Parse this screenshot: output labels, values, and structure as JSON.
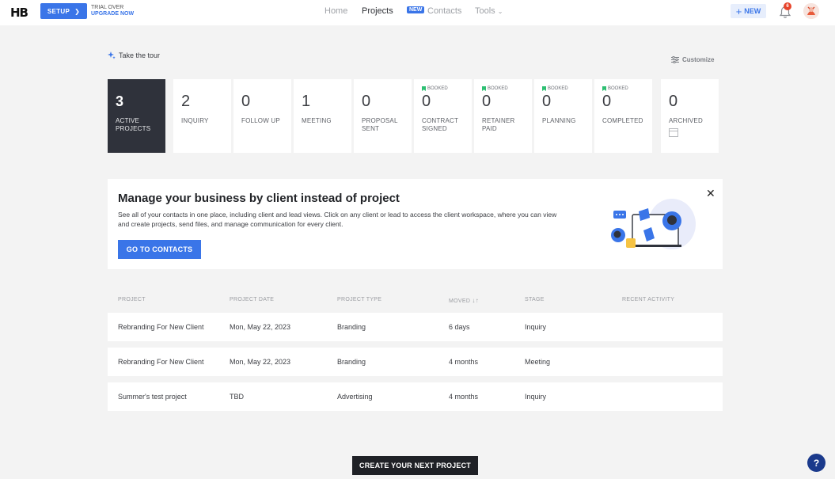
{
  "header": {
    "logo": "HB",
    "setup_label": "SETUP",
    "trial_status": "TRIAL OVER",
    "upgrade_label": "UPGRADE NOW",
    "nav": {
      "home": "Home",
      "projects": "Projects",
      "new_badge": "NEW",
      "contacts": "Contacts",
      "tools": "Tools"
    },
    "new_button": "NEW",
    "notification_count": "6"
  },
  "toolbar": {
    "tour": "Take the tour",
    "customize": "Customize"
  },
  "stages": [
    {
      "count": "3",
      "label": "ACTIVE PROJECTS",
      "booked": ""
    },
    {
      "count": "2",
      "label": "INQUIRY",
      "booked": ""
    },
    {
      "count": "0",
      "label": "FOLLOW UP",
      "booked": ""
    },
    {
      "count": "1",
      "label": "MEETING",
      "booked": ""
    },
    {
      "count": "0",
      "label": "PROPOSAL SENT",
      "booked": ""
    },
    {
      "count": "0",
      "label": "CONTRACT SIGNED",
      "booked": "BOOKED"
    },
    {
      "count": "0",
      "label": "RETAINER PAID",
      "booked": "BOOKED"
    },
    {
      "count": "0",
      "label": "PLANNING",
      "booked": "BOOKED"
    },
    {
      "count": "0",
      "label": "COMPLETED",
      "booked": "BOOKED"
    },
    {
      "count": "0",
      "label": "ARCHIVED",
      "booked": ""
    }
  ],
  "promo": {
    "title": "Manage your business by client instead of project",
    "body": "See all of your contacts in one place, including client and lead views. Click on any client or lead to access the client workspace, where you can view and create projects, send files, and manage communication for every client.",
    "button": "GO TO CONTACTS"
  },
  "table": {
    "headers": [
      "PROJECT",
      "PROJECT DATE",
      "PROJECT TYPE",
      "MOVED",
      "STAGE",
      "RECENT ACTIVITY"
    ],
    "rows": [
      {
        "project": "Rebranding For New Client",
        "date": "Mon, May 22, 2023",
        "type": "Branding",
        "moved": "6 days",
        "stage": "Inquiry",
        "activity": ""
      },
      {
        "project": "Rebranding For New Client",
        "date": "Mon, May 22, 2023",
        "type": "Branding",
        "moved": "4 months",
        "stage": "Meeting",
        "activity": ""
      },
      {
        "project": "Summer's test project",
        "date": "TBD",
        "type": "Advertising",
        "moved": "4 months",
        "stage": "Inquiry",
        "activity": ""
      }
    ]
  },
  "footer": {
    "create_button": "CREATE YOUR NEXT PROJECT",
    "help": "?"
  },
  "colors": {
    "accent": "#3a75e8",
    "dark": "#2f323b",
    "booked": "#2dbf72",
    "badge": "#e7452c"
  }
}
